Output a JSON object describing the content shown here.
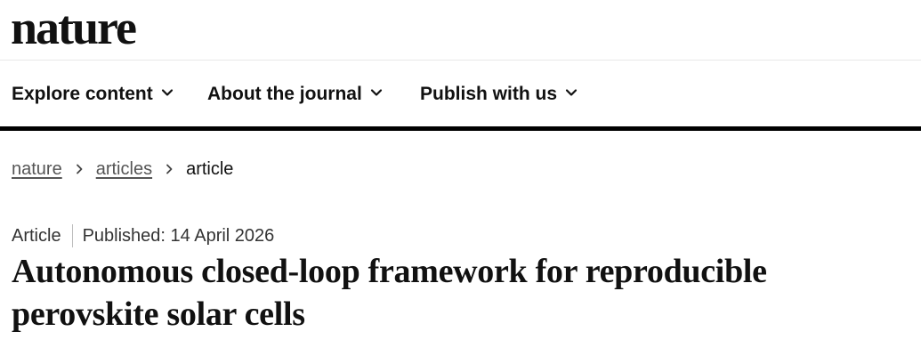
{
  "site": {
    "logo": "nature"
  },
  "nav": {
    "items": [
      {
        "label": "Explore content"
      },
      {
        "label": "About the journal"
      },
      {
        "label": "Publish with us"
      }
    ]
  },
  "breadcrumb": {
    "items": [
      {
        "label": "nature"
      },
      {
        "label": "articles"
      },
      {
        "label": "article"
      }
    ]
  },
  "article": {
    "type": "Article",
    "published": "Published: 14 April 2026",
    "title": "Autonomous closed-loop framework for reproducible perovskite solar cells"
  },
  "icons": {
    "nav_chevron": "chevron-down-icon",
    "breadcrumb_separator": "chevron-right-icon"
  },
  "colors": {
    "text": "#111111",
    "link_muted": "#555555",
    "divider": "#000000"
  }
}
